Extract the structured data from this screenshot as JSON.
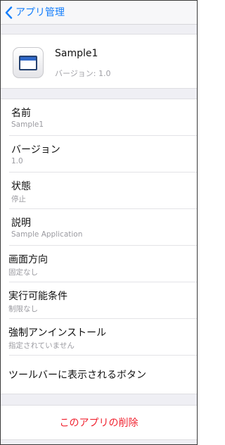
{
  "nav": {
    "back_label": "アプリ管理",
    "back_icon": "chevron-left-icon",
    "accent_color": "#147efb"
  },
  "app": {
    "name": "Sample1",
    "version_text": "バージョン: 1.0",
    "icon": "app-window-icon"
  },
  "properties": [
    {
      "label": "名前",
      "value": "Sample1"
    },
    {
      "label": "バージョン",
      "value": "1.0"
    },
    {
      "label": "状態",
      "value": "停止"
    },
    {
      "label": "説明",
      "value": "Sample Application"
    },
    {
      "label": "画面方向",
      "value": "固定なし"
    },
    {
      "label": "実行可能条件",
      "value": "制限なし"
    },
    {
      "label": "強制アンインストール",
      "value": "指定されていません"
    },
    {
      "label": "ツールバーに表示されるボタン"
    }
  ],
  "actions": {
    "delete_label": "このアプリの削除",
    "delete_color": "#f0222f"
  }
}
